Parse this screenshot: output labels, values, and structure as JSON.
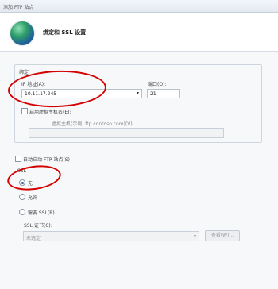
{
  "window": {
    "title": "添加 FTP 站点"
  },
  "header": {
    "title": "绑定和 SSL 设置",
    "icon": "globe-icon"
  },
  "binding": {
    "group_label": "绑定",
    "ip_label": "IP 地址(A):",
    "ip_value": "10.11.17.245",
    "port_label": "端口(O):",
    "port_value": "21",
    "virtual_host_checkbox_label": "启用虚拟主机名(E):",
    "virtual_host_checked": false,
    "virtual_host_hint": "虚拟主机(示例: ftp.contoso.com)(V):",
    "virtual_host_value": ""
  },
  "auto_start": {
    "label": "自动启动 FTP 站点(S)",
    "checked": false
  },
  "ssl": {
    "group_label": "SSL",
    "options": [
      {
        "label": "无",
        "checked": true
      },
      {
        "label": "允许",
        "checked": false
      },
      {
        "label": "需要 SSL(R)",
        "checked": false
      }
    ],
    "cert_label": "SSL 证书(C):",
    "cert_value": "未选定",
    "view_button": "查看(W)..."
  },
  "annotation_color": "#d40000"
}
